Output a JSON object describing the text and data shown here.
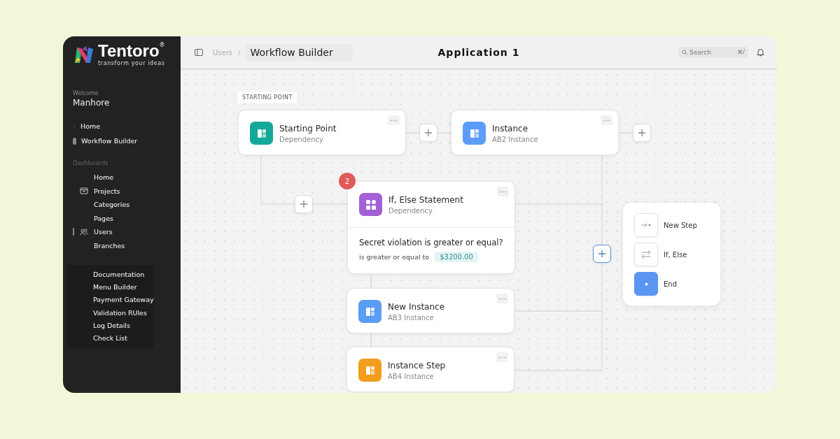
{
  "sidebar": {
    "logo": {
      "name": "Tentoro",
      "mark": "®",
      "tagline": "transform your ideas"
    },
    "welcome": "Welcome",
    "user": "Manhore",
    "nav": [
      {
        "label": "Home",
        "selected": false
      },
      {
        "label": "Workflow Builder",
        "selected": true
      }
    ],
    "section_title": "Dashboards",
    "dashboards": [
      {
        "label": "Home",
        "kind": "plain",
        "selected": false
      },
      {
        "label": "Projects",
        "kind": "inbox",
        "selected": false
      },
      {
        "label": "Categories",
        "kind": "plain",
        "selected": false
      },
      {
        "label": "Pages",
        "kind": "plain",
        "selected": false
      },
      {
        "label": "Users",
        "kind": "users",
        "selected": true
      },
      {
        "label": "Branches",
        "kind": "plain",
        "selected": false
      }
    ],
    "extras": [
      "Documentation",
      "Menu Builder",
      "Payment Gateway",
      "Validation RUles",
      "Log Details",
      "Check List"
    ]
  },
  "header": {
    "breadcrumb": "Users",
    "separator": "/",
    "page": "Workflow Builder",
    "title": "Application 1",
    "search": {
      "placeholder": "Search",
      "shortcut": "⌘/"
    }
  },
  "canvas": {
    "start_label": "STARTING POINT",
    "nodes": [
      {
        "kind": "step",
        "title": "Starting Point",
        "subtitle": "Dependency",
        "color": "#14a89a"
      },
      {
        "kind": "step",
        "title": "Instance",
        "subtitle": "AB2 Instance",
        "color": "#5b9cf6"
      },
      {
        "kind": "condition",
        "badge": "2",
        "title": "If, Else Statement",
        "subtitle": "Dependency",
        "color": "#a35fd6",
        "question": "Secret violation is greater or equal?",
        "operator": "is greater or equal to",
        "value": "$3200.00"
      },
      {
        "kind": "step",
        "title": "New Instance",
        "subtitle": "AB3 Instance",
        "color": "#5b9cf6"
      },
      {
        "kind": "step",
        "title": "Instance Step",
        "subtitle": "AB4 Instance",
        "color": "#f29d1c"
      }
    ],
    "add_step_menu": {
      "options": [
        {
          "kind": "step",
          "label": "New Step",
          "selected": false
        },
        {
          "kind": "branch",
          "label": "If, Else",
          "selected": false
        },
        {
          "kind": "end",
          "label": "End",
          "selected": true
        }
      ]
    }
  }
}
